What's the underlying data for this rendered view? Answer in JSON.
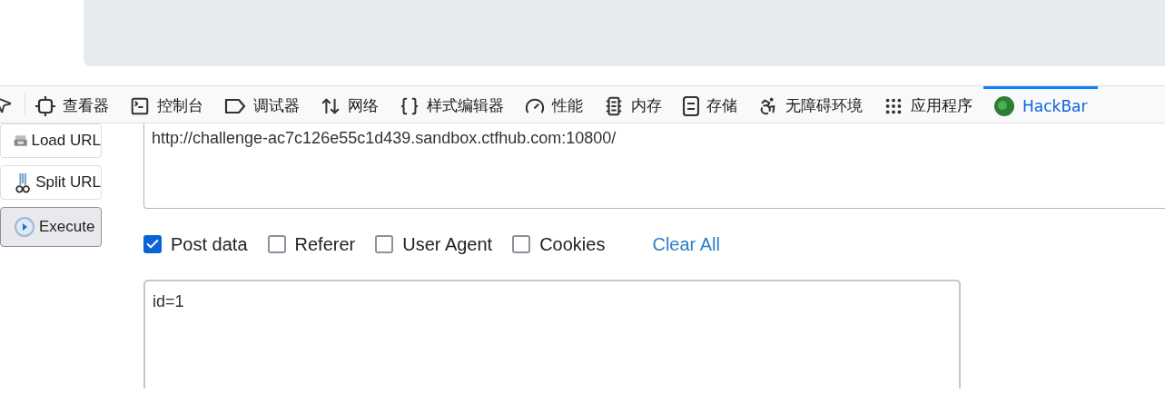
{
  "toolbar": {
    "tabs": [
      {
        "kind": "inspector",
        "label": "查看器",
        "selected": false
      },
      {
        "kind": "console",
        "label": "控制台",
        "selected": false
      },
      {
        "kind": "debugger",
        "label": "调试器",
        "selected": false
      },
      {
        "kind": "network",
        "label": "网络",
        "selected": false
      },
      {
        "kind": "style",
        "label": "样式编辑器",
        "selected": false
      },
      {
        "kind": "performance",
        "label": "性能",
        "selected": false
      },
      {
        "kind": "memory",
        "label": "内存",
        "selected": false
      },
      {
        "kind": "storage",
        "label": "存储",
        "selected": false
      },
      {
        "kind": "accessibility",
        "label": "无障碍环境",
        "selected": false
      },
      {
        "kind": "application",
        "label": "应用程序",
        "selected": false
      },
      {
        "kind": "hackbar",
        "label": "HackBar",
        "selected": true
      }
    ]
  },
  "side_buttons": [
    {
      "kind": "load",
      "label": "Load URL",
      "pressed": false
    },
    {
      "kind": "split",
      "label": "Split URL",
      "pressed": false
    },
    {
      "kind": "execute",
      "label": "Execute",
      "pressed": true
    }
  ],
  "url": {
    "value": "http://challenge-ac7c126e55c1d439.sandbox.ctfhub.com:10800/"
  },
  "options": [
    {
      "label": "Post data",
      "checked": true
    },
    {
      "label": "Referer",
      "checked": false
    },
    {
      "label": "User Agent",
      "checked": false
    },
    {
      "label": "Cookies",
      "checked": false
    }
  ],
  "clear_all": "Clear All",
  "post_data": {
    "value": "id=1"
  }
}
